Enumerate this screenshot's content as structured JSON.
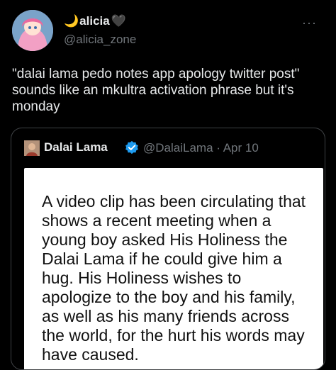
{
  "tweet": {
    "display_name": "alicia",
    "moon_icon": "🌙",
    "heart_icon": "🖤",
    "handle": "@alicia_zone",
    "more_icon": "···",
    "text": "\"dalai lama pedo notes app apology twitter post\" sounds like an mkultra activation phrase but it's monday"
  },
  "quoted_tweet": {
    "display_name": "Dalai Lama",
    "handle_and_date": "@DalaiLama · Apr 10",
    "image_text": "A video clip has been circulating that shows a recent meeting when a young boy asked His Holiness the Dalai Lama if he could give him a hug. His Holiness wishes to apologize to the boy and his family, as well as his many friends across the world, for the hurt his words may have caused."
  },
  "colors": {
    "background": "#000000",
    "primary_text": "#e7e9ea",
    "secondary_text": "#71767b",
    "border": "#3e4144",
    "verified": "#1d9bf0"
  }
}
